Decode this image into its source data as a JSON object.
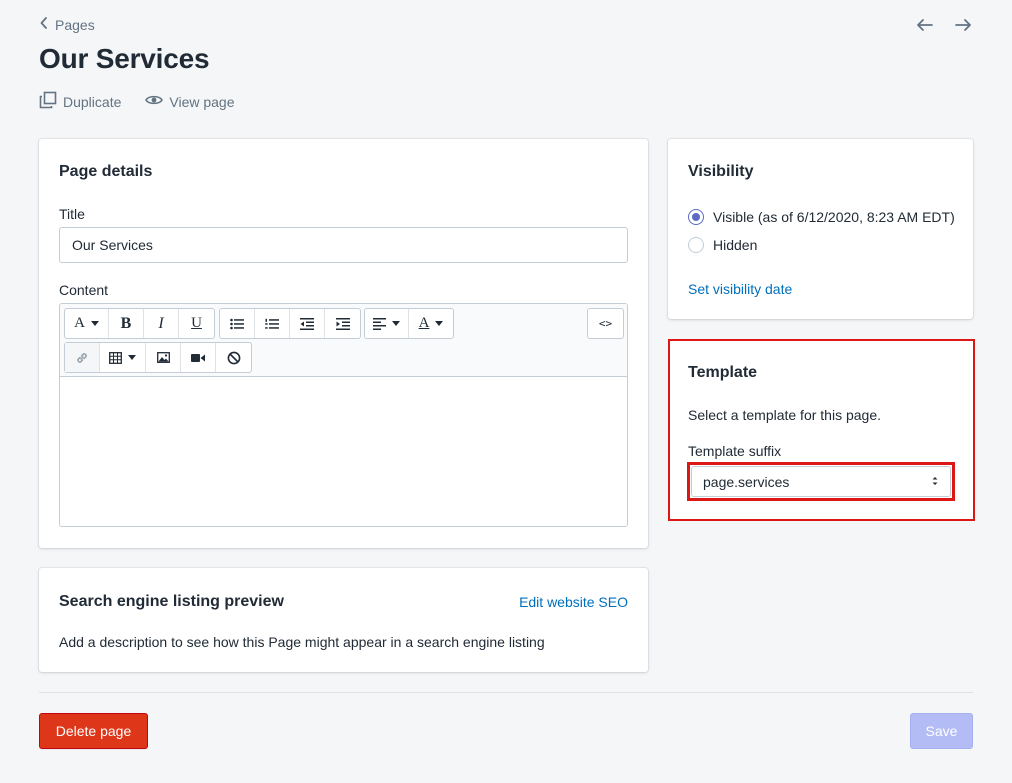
{
  "breadcrumb": {
    "label": "Pages"
  },
  "page": {
    "title": "Our Services"
  },
  "actions": {
    "duplicate": "Duplicate",
    "view_page": "View page"
  },
  "details": {
    "heading": "Page details",
    "title_label": "Title",
    "title_value": "Our Services",
    "content_label": "Content",
    "toolbar": {
      "row1": [
        "font-color",
        "bold",
        "italic",
        "underline",
        "bullet-list",
        "numbered-list",
        "outdent",
        "indent",
        "align",
        "text-color",
        "show-html"
      ],
      "row2": [
        "link",
        "table",
        "image",
        "video",
        "clear-formatting"
      ],
      "bold_glyph": "B",
      "italic_glyph": "I",
      "underline_glyph": "U",
      "font_glyph": "A",
      "html_glyph": "<>"
    }
  },
  "seo": {
    "heading": "Search engine listing preview",
    "edit_link": "Edit website SEO",
    "description": "Add a description to see how this Page might appear in a search engine listing"
  },
  "visibility": {
    "heading": "Visibility",
    "options": [
      {
        "label": "Visible (as of 6/12/2020, 8:23 AM EDT)",
        "checked": true
      },
      {
        "label": "Hidden",
        "checked": false
      }
    ],
    "set_date_link": "Set visibility date"
  },
  "template": {
    "heading": "Template",
    "description": "Select a template for this page.",
    "suffix_label": "Template suffix",
    "suffix_value": "page.services"
  },
  "footer": {
    "delete_label": "Delete page",
    "save_label": "Save"
  },
  "colors": {
    "accent": "#5c6ac4",
    "link": "#006fbb",
    "danger": "#de3618",
    "highlight": "#dd1616",
    "save_disabled": "#b3bcf5"
  }
}
